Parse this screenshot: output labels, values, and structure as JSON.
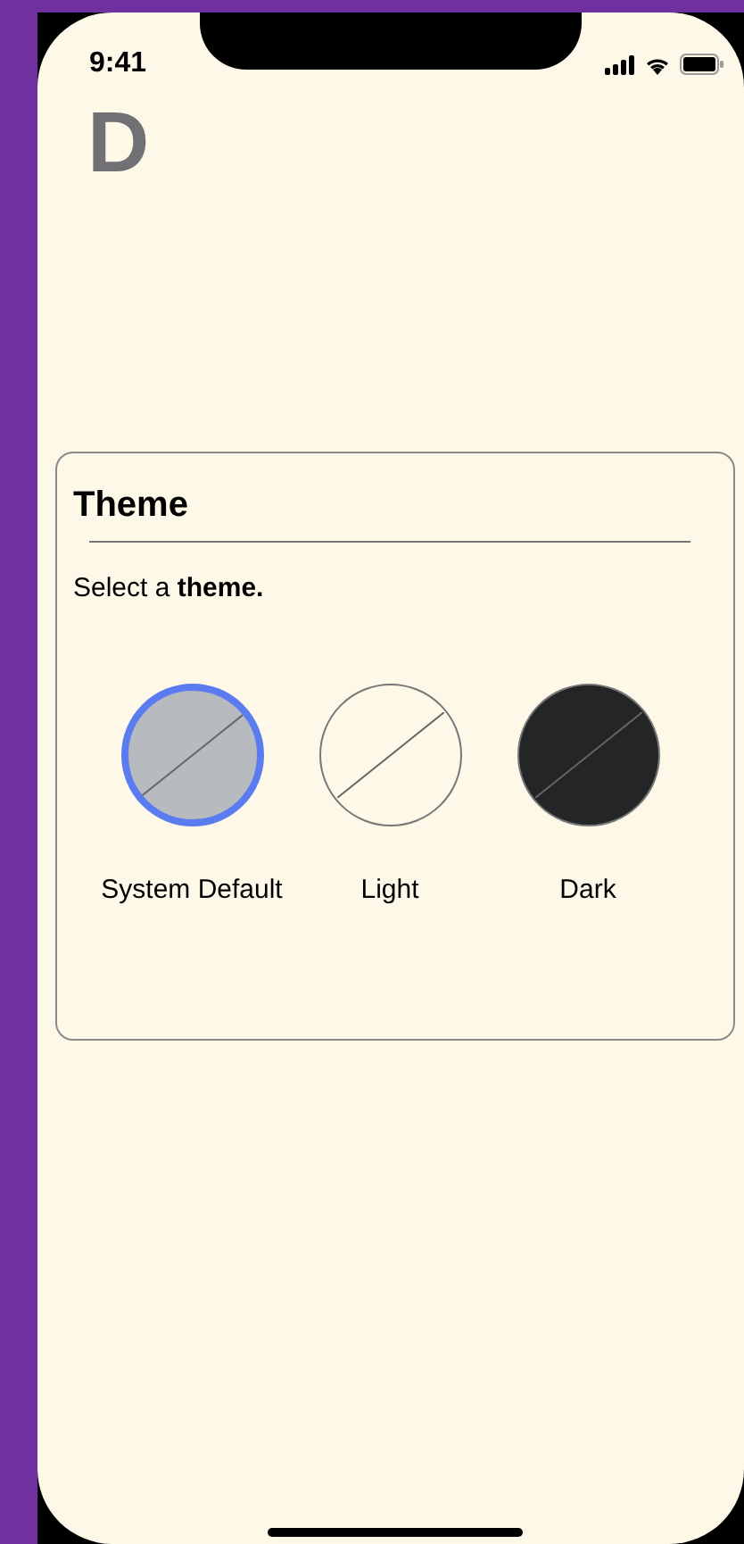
{
  "status_bar": {
    "time": "9:41"
  },
  "logo": "D",
  "card": {
    "title": "Theme",
    "description": "Select a **theme.**",
    "options": [
      {
        "label": "System Default",
        "selected": true,
        "color": "#b7babf"
      },
      {
        "label": "Light",
        "selected": false,
        "color": "#fdf8e7"
      },
      {
        "label": "Dark",
        "selected": false,
        "color": "#242527"
      }
    ]
  }
}
